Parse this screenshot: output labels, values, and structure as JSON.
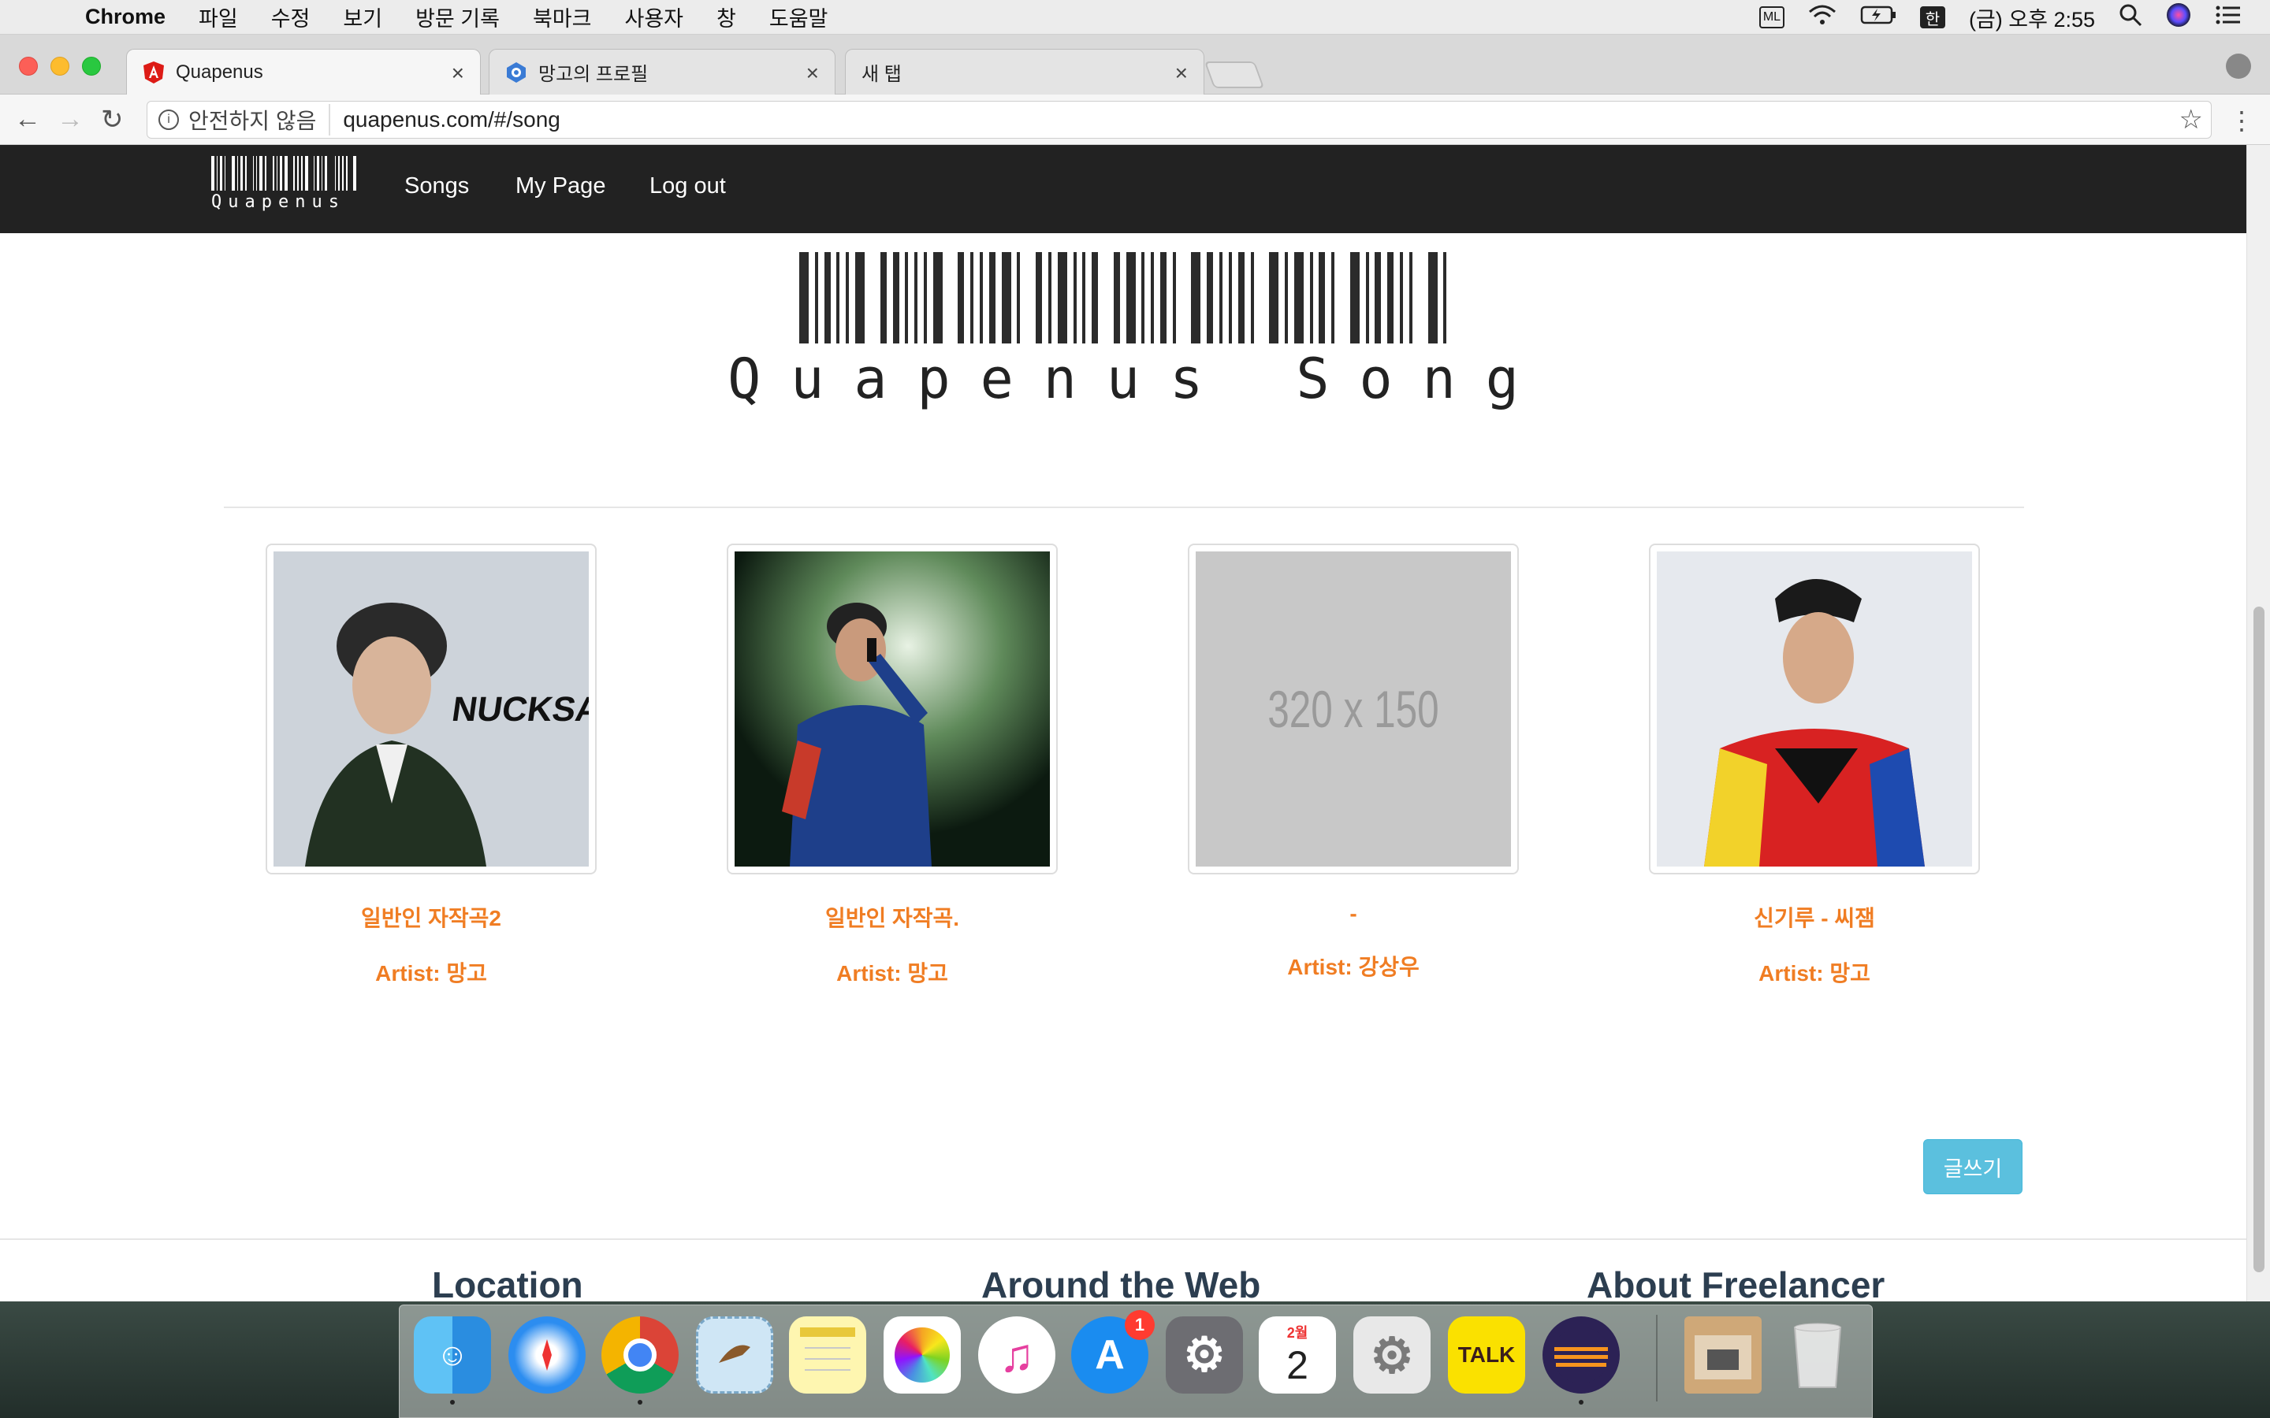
{
  "menubar": {
    "app_name": "Chrome",
    "items": [
      "파일",
      "수정",
      "보기",
      "방문 기록",
      "북마크",
      "사용자",
      "창",
      "도움말"
    ],
    "status": {
      "ime": "한",
      "ml": "ML",
      "clock": "(금) 오후 2:55"
    }
  },
  "tabs": [
    {
      "label": "Quapenus",
      "active": true
    },
    {
      "label": "망고의 프로필",
      "active": false
    },
    {
      "label": "새 탭",
      "active": false
    }
  ],
  "address_bar": {
    "security_label": "안전하지 않음",
    "url": "quapenus.com/#/song"
  },
  "navbar": {
    "brand": "Quapenus",
    "links": [
      "Songs",
      "My Page",
      "Log out"
    ]
  },
  "hero": {
    "title": "Quapenus Song"
  },
  "songs": [
    {
      "title": "일반인 자작곡2",
      "artist": "Artist: 망고",
      "image": "photo"
    },
    {
      "title": "일반인 자작곡.",
      "artist": "Artist: 망고",
      "image": "photo"
    },
    {
      "title": "-",
      "artist": "Artist: 강상우",
      "image": "placeholder",
      "placeholder_text": "320 x 150"
    },
    {
      "title": "신기루 - 씨잼",
      "artist": "Artist: 망고",
      "image": "photo"
    }
  ],
  "write_button": "글쓰기",
  "footer": {
    "headings": [
      "Location",
      "Around the Web",
      "About Freelancer"
    ]
  },
  "dock": {
    "calendar_month": "2월",
    "calendar_day": "2",
    "kakao_label": "TALK",
    "appstore_badge": "1"
  },
  "colors": {
    "accent_orange": "#f07d23",
    "navbar_bg": "#222222",
    "write_button": "#5bc0de"
  }
}
